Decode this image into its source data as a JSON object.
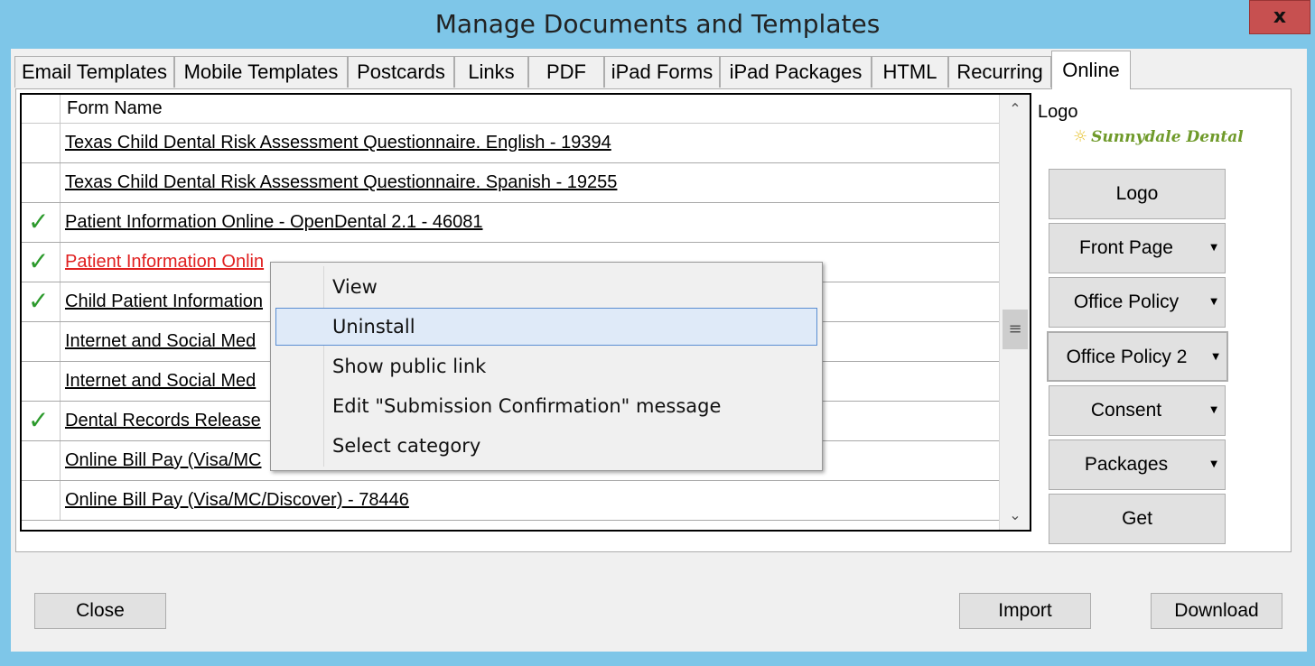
{
  "window": {
    "title": "Manage Documents and Templates",
    "close_glyph": "x"
  },
  "tabs": [
    {
      "label": "Email Templates"
    },
    {
      "label": "Mobile Templates"
    },
    {
      "label": "Postcards"
    },
    {
      "label": "Links"
    },
    {
      "label": "PDF"
    },
    {
      "label": "iPad Forms"
    },
    {
      "label": "iPad Packages"
    },
    {
      "label": "HTML"
    },
    {
      "label": "Recurring"
    },
    {
      "label": "Online",
      "active": true
    }
  ],
  "grid": {
    "column_header": "Form Name",
    "rows": [
      {
        "checked": false,
        "name": "Texas Child Dental Risk Assessment Questionnaire. English - 19394"
      },
      {
        "checked": false,
        "name": "Texas Child Dental Risk Assessment Questionnaire. Spanish - 19255"
      },
      {
        "checked": true,
        "name": "Patient Information Online - OpenDental 2.1 - 46081"
      },
      {
        "checked": true,
        "name": "Patient Information Onlin",
        "highlight_color": "#e02020"
      },
      {
        "checked": true,
        "name": "Child Patient Information"
      },
      {
        "checked": false,
        "name": "Internet and Social Med"
      },
      {
        "checked": false,
        "name": "Internet and Social Med"
      },
      {
        "checked": true,
        "name": "Dental Records Release"
      },
      {
        "checked": false,
        "name": "Online Bill Pay (Visa/MC"
      },
      {
        "checked": false,
        "name": "Online Bill Pay (Visa/MC/Discover) - 78446"
      }
    ],
    "check_glyph": "✓",
    "scroll_up_glyph": "⌃",
    "scroll_down_glyph": "⌄",
    "scroll_thumb_glyph": "≡"
  },
  "side_panel": {
    "logo_label": "Logo",
    "logo_text": "Sunnydale Dental",
    "logo_icon": "sun-icon",
    "buttons": [
      {
        "label": "Logo",
        "dropdown": false
      },
      {
        "label": "Front Page",
        "dropdown": true
      },
      {
        "label": "Office Policy",
        "dropdown": true
      },
      {
        "label": "Office Policy 2",
        "dropdown": true
      },
      {
        "label": "Consent",
        "dropdown": true
      },
      {
        "label": "Packages",
        "dropdown": true
      },
      {
        "label": "Get",
        "dropdown": false
      }
    ],
    "dropdown_glyph": "▼"
  },
  "context_menu": {
    "items": [
      {
        "label": "View"
      },
      {
        "label": "Uninstall",
        "hover": true
      },
      {
        "label": "Show public link"
      },
      {
        "label": "Edit \"Submission Confirmation\" message"
      },
      {
        "label": "Select category"
      }
    ]
  },
  "footer": {
    "close_label": "Close",
    "import_label": "Import",
    "download_label": "Download"
  },
  "colors": {
    "window_frame": "#7ec6e8",
    "close_button": "#c75050",
    "check": "#2c9a2c",
    "menu_hover": "#dfeaf8"
  }
}
